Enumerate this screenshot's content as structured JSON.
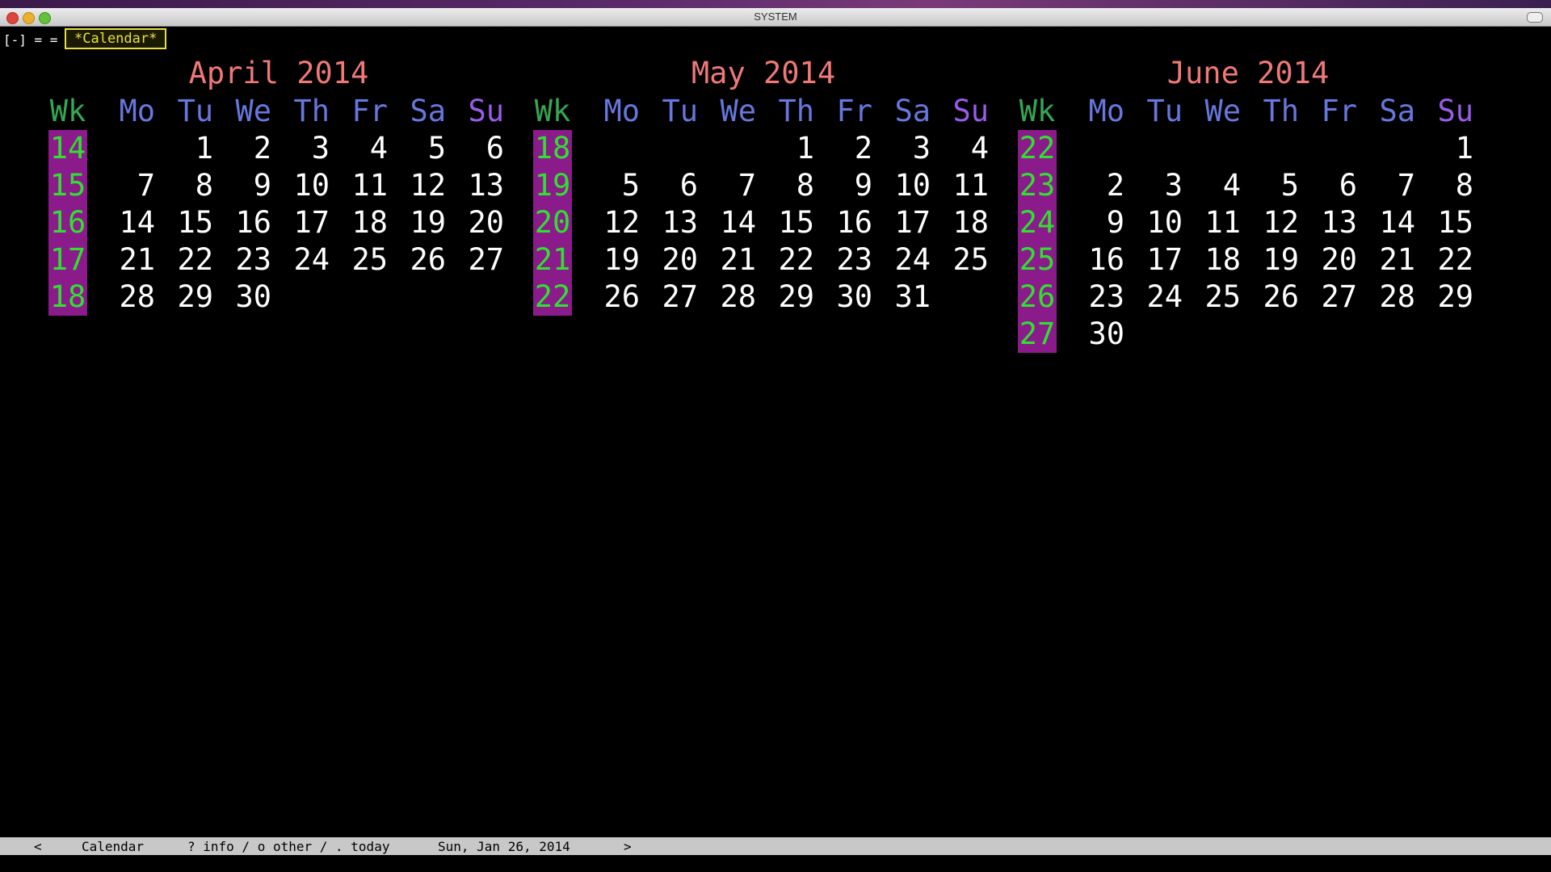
{
  "window": {
    "title": "SYSTEM"
  },
  "tabbar": {
    "prefix": "[-] = =",
    "active_tab": "*Calendar*"
  },
  "day_headers": [
    "Wk",
    "Mo",
    "Tu",
    "We",
    "Th",
    "Fr",
    "Sa",
    "Su"
  ],
  "months": [
    {
      "title": "April 2014",
      "rows": [
        {
          "wk": "14",
          "days": [
            "",
            "1",
            "2",
            "3",
            "4",
            "5",
            "6"
          ]
        },
        {
          "wk": "15",
          "days": [
            "7",
            "8",
            "9",
            "10",
            "11",
            "12",
            "13"
          ]
        },
        {
          "wk": "16",
          "days": [
            "14",
            "15",
            "16",
            "17",
            "18",
            "19",
            "20"
          ]
        },
        {
          "wk": "17",
          "days": [
            "21",
            "22",
            "23",
            "24",
            "25",
            "26",
            "27"
          ]
        },
        {
          "wk": "18",
          "days": [
            "28",
            "29",
            "30",
            "",
            "",
            "",
            ""
          ]
        }
      ]
    },
    {
      "title": "May 2014",
      "rows": [
        {
          "wk": "18",
          "days": [
            "",
            "",
            "",
            "1",
            "2",
            "3",
            "4"
          ]
        },
        {
          "wk": "19",
          "days": [
            "5",
            "6",
            "7",
            "8",
            "9",
            "10",
            "11"
          ]
        },
        {
          "wk": "20",
          "days": [
            "12",
            "13",
            "14",
            "15",
            "16",
            "17",
            "18"
          ]
        },
        {
          "wk": "21",
          "days": [
            "19",
            "20",
            "21",
            "22",
            "23",
            "24",
            "25"
          ]
        },
        {
          "wk": "22",
          "days": [
            "26",
            "27",
            "28",
            "29",
            "30",
            "31",
            ""
          ]
        }
      ]
    },
    {
      "title": "June 2014",
      "rows": [
        {
          "wk": "22",
          "days": [
            "",
            "",
            "",
            "",
            "",
            "",
            "1"
          ]
        },
        {
          "wk": "23",
          "days": [
            "2",
            "3",
            "4",
            "5",
            "6",
            "7",
            "8"
          ]
        },
        {
          "wk": "24",
          "days": [
            "9",
            "10",
            "11",
            "12",
            "13",
            "14",
            "15"
          ]
        },
        {
          "wk": "25",
          "days": [
            "16",
            "17",
            "18",
            "19",
            "20",
            "21",
            "22"
          ]
        },
        {
          "wk": "26",
          "days": [
            "23",
            "24",
            "25",
            "26",
            "27",
            "28",
            "29"
          ]
        },
        {
          "wk": "27",
          "days": [
            "30",
            "",
            "",
            "",
            "",
            "",
            ""
          ]
        }
      ]
    }
  ],
  "statusbar": {
    "prev": "<",
    "mode": "Calendar",
    "hints": "? info / o other / . today",
    "date": "Sun, Jan 26, 2014",
    "next": ">"
  },
  "colors": {
    "month_title": "#f07878",
    "day_header": "#6677dd",
    "week_header": "#34a853",
    "week_bg": "#8b1a8b",
    "week_fg": "#30e030",
    "tab_border": "#e8e040"
  }
}
